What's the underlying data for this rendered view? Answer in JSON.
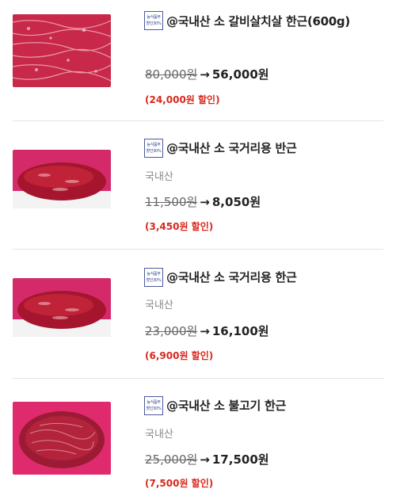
{
  "badge": {
    "line1": "농식품부",
    "line2": "할인30%"
  },
  "products": [
    {
      "title": "@국내산 소 갈비살치살 한근(600g)",
      "origin": "",
      "original_price": "80,000원",
      "arrow": "→",
      "sale_price": "56,000원",
      "discount": "(24,000원 할인)",
      "image": "marbled-beef-photo"
    },
    {
      "title": "@국내산 소 국거리용 반근",
      "origin": "국내산",
      "original_price": "11,500원",
      "arrow": "→",
      "sale_price": "8,050원",
      "discount": "(3,450원 할인)",
      "image": "soup-beef-tray-photo"
    },
    {
      "title": "@국내산 소 국거리용 한근",
      "origin": "국내산",
      "original_price": "23,000원",
      "arrow": "→",
      "sale_price": "16,100원",
      "discount": "(6,900원 할인)",
      "image": "soup-beef-tray-photo"
    },
    {
      "title": "@국내산 소 불고기 한근",
      "origin": "국내산",
      "original_price": "25,000원",
      "arrow": "→",
      "sale_price": "17,500원",
      "discount": "(7,500원 할인)",
      "image": "bulgogi-beef-photo"
    }
  ],
  "colors": {
    "discount": "#d8281e",
    "badge_border": "#4b5a9a",
    "meat": "#c01a3a"
  }
}
